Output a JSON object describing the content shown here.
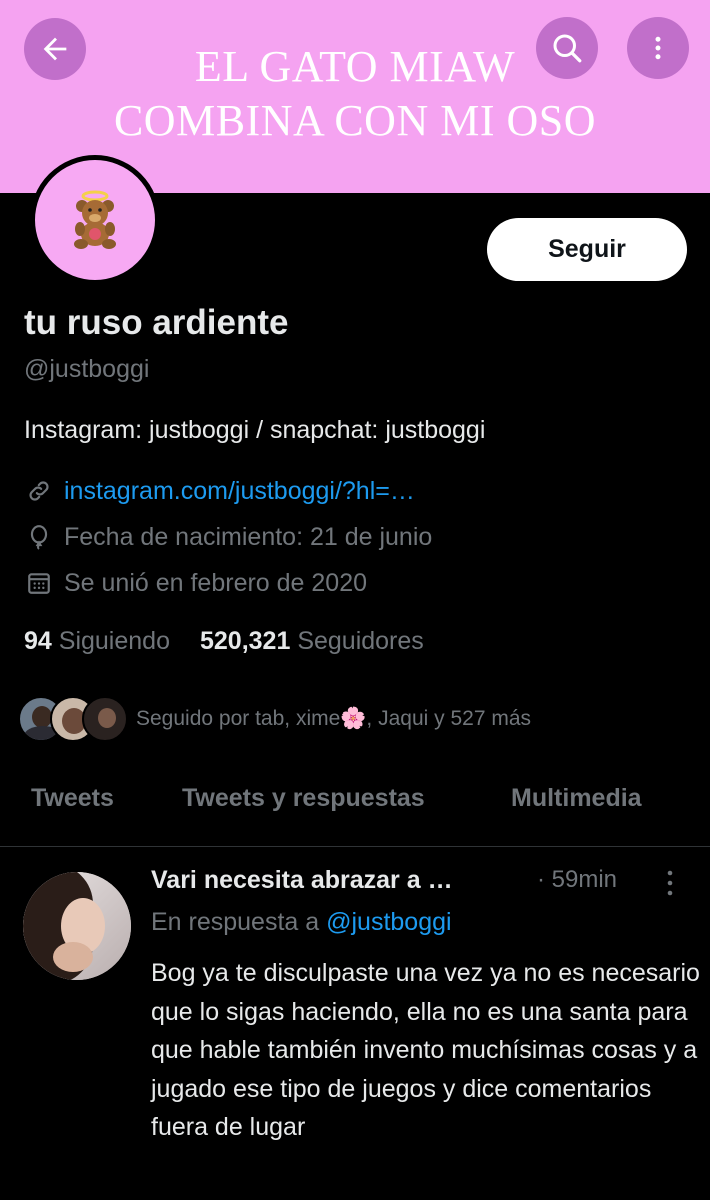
{
  "banner": {
    "line1": "EL GATO MIAW",
    "line2": "COMBINA CON MI OSO",
    "background": "#f5a3f1"
  },
  "header": {
    "back_icon": "arrow-left-icon",
    "search_icon": "search-icon",
    "more_icon": "more-vertical-icon"
  },
  "profile": {
    "avatar_icon": "teddy-bear-angel-icon",
    "follow_label": "Seguir",
    "name": "tu ruso ardiente",
    "handle": "@justboggi",
    "bio": "Instagram: justboggi / snapchat: justboggi",
    "link": "instagram.com/justboggi/?hl=…",
    "birthday": "Fecha de nacimiento: 21 de junio",
    "joined": "Se unió en febrero de 2020",
    "following_count": "94",
    "following_label": "Siguiendo",
    "followers_count": "520,321",
    "followers_label": "Seguidores",
    "followed_by": "Seguido por tab, xime🌸, Jaqui y 527 más"
  },
  "tabs": [
    {
      "label": "Tweets"
    },
    {
      "label": "Tweets y respuestas"
    },
    {
      "label": "Multimedia"
    }
  ],
  "tweet": {
    "author": "Vari necesita abrazar a …",
    "time": "· 59min",
    "reply_prefix": "En respuesta a",
    "reply_mention": "@justboggi",
    "body": "Bog ya te disculpaste una vez ya no es necesario que lo sigas haciendo, ella no es una santa para que hable también invento muchísimas cosas y a jugado ese tipo de juegos y dice comentarios fuera de lugar"
  },
  "colors": {
    "accent": "#1d9bf0",
    "muted": "#71767b",
    "text": "#e7e9ea",
    "background": "#000000"
  }
}
